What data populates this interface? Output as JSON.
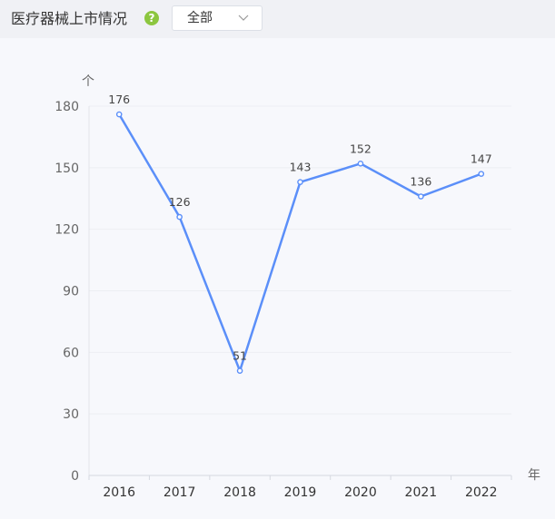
{
  "header": {
    "title": "医疗器械上市情况",
    "help_icon": "question-circle-icon",
    "filter": {
      "selected": "全部"
    }
  },
  "colors": {
    "line": "#5b8ff9",
    "help": "#8cc63f"
  },
  "chart_data": {
    "type": "line",
    "categories": [
      "2016",
      "2017",
      "2018",
      "2019",
      "2020",
      "2021",
      "2022"
    ],
    "values": [
      176,
      126,
      51,
      143,
      152,
      136,
      147
    ],
    "yticks": [
      0,
      30,
      60,
      90,
      120,
      150,
      180
    ],
    "ylim": [
      0,
      180
    ],
    "ylabel": "个",
    "xlabel": "年",
    "grid": true,
    "data_labels": true
  }
}
